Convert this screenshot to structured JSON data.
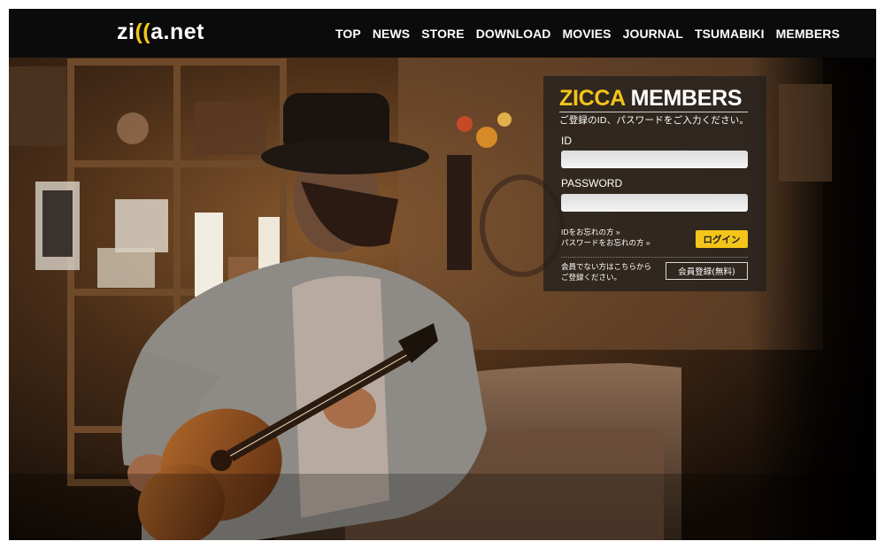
{
  "site": {
    "logo_text_a": "zi",
    "logo_text_b": "((",
    "logo_text_c": "a.net",
    "accent_color": "#f3c51a"
  },
  "nav": {
    "items": [
      {
        "label": "TOP"
      },
      {
        "label": "NEWS"
      },
      {
        "label": "STORE"
      },
      {
        "label": "DOWNLOAD"
      },
      {
        "label": "MOVIES"
      },
      {
        "label": "JOURNAL"
      },
      {
        "label": "TSUMABIKI"
      },
      {
        "label": "MEMBERS"
      }
    ]
  },
  "login": {
    "title_highlight": "ZICCA",
    "title_rest": "MEMBERS",
    "subtitle": "ご登録のID、パスワードをご入力ください。",
    "id_label": "ID",
    "id_value": "",
    "password_label": "PASSWORD",
    "password_value": "",
    "forgot_id": "IDをお忘れの方 »",
    "forgot_password": "パスワードをお忘れの方 »",
    "login_button": "ログイン",
    "register_note_line1": "会員でない方はこちらから",
    "register_note_line2": "ご登録ください。",
    "register_button": "会員登録(無料)"
  },
  "background": {
    "description_icon": "photo-guitarist-icon"
  }
}
